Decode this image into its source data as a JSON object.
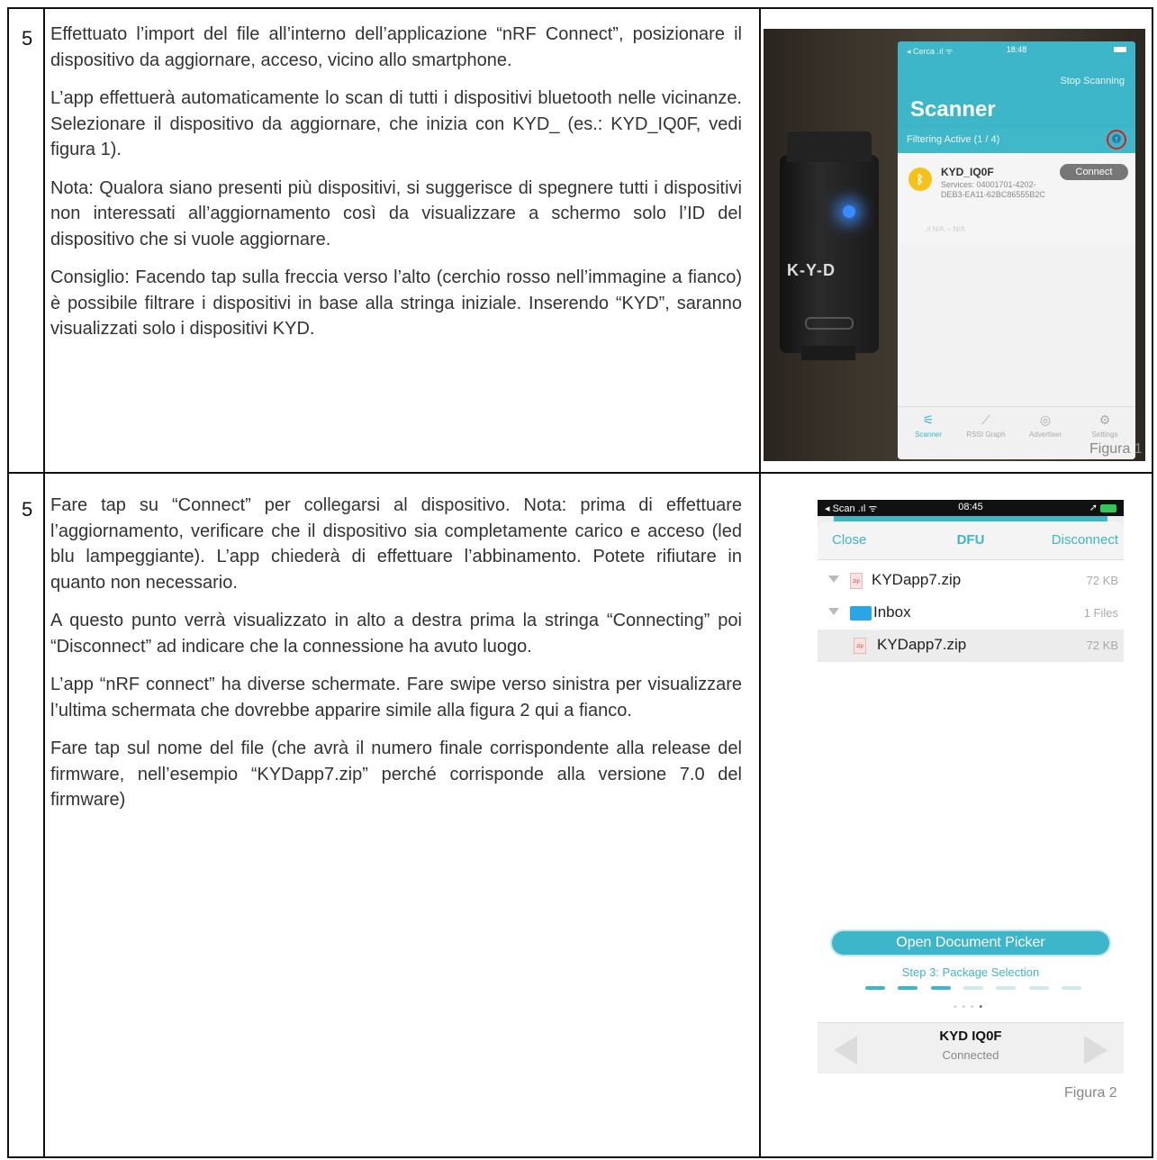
{
  "rows": [
    {
      "step": "5",
      "paragraphs": [
        "Effettuato l’import del file all’interno dell’applicazione “nRF Connect”, posizionare il dispositivo da aggiornare, acceso, vicino allo smartphone.",
        "L’app effettuerà automaticamente lo scan di tutti i dispositivi bluetooth nelle vicinanze. Selezionare il dispositivo da aggiornare, che inizia con KYD_ (es.: KYD_IQ0F, vedi figura 1).",
        "Nota: Qualora siano presenti più dispositivi, si suggerisce di spegnere tutti i dispositivi non interessati all’aggiornamento così da visualizzare a schermo solo l’ID del dispositivo che si vuole aggiornare.",
        "Consiglio: Facendo tap sulla freccia verso l’alto (cerchio rosso nell’immagine a fianco) è possibile filtrare i dispositivi in base alla stringa iniziale. Inserendo “KYD”, saranno visualizzati solo i dispositivi KYD."
      ],
      "caption": "Figura 1"
    },
    {
      "step": "5",
      "paragraphs": [
        "Fare tap su “Connect” per collegarsi al dispositivo. Nota: prima di effettuare l’aggiornamento, verificare che il dispositivo sia completamente carico e acceso (led blu lampeggiante). L’app chiederà di effettuare l’abbinamento. Potete rifiutare in quanto non necessario.",
        "A questo punto verrà visualizzato in alto a destra prima la stringa “Connecting” poi “Disconnect” ad indicare che la connessione ha avuto luogo.",
        "L’app “nRF connect” ha diverse schermate. Fare swipe verso sinistra per visualizzare l’ultima schermata che dovrebbe apparire simile alla figura 2 qui a fianco.",
        "Fare tap sul nome del file (che avrà il numero finale corrispondente alla release del firmware, nell’esempio “KYDapp7.zip” perché corrisponde alla versione 7.0 del firmware)"
      ],
      "caption": "Figura 2"
    }
  ],
  "figure1": {
    "device_logo": "K-Y-D",
    "status_left": "◂ Cerca .ıl ᯤ",
    "status_time": "18:48",
    "stop_scanning": "Stop Scanning",
    "title": "Scanner",
    "filter_text": "Filtering Active (1 / 4)",
    "device_name": "KYD_IQ0F",
    "connect_label": "Connect",
    "services": "Services: 04001701-4202-DEB3-EA11-62BC86555B2C",
    "rssi": ".ıl N/A  ◦◦ N/A",
    "tabs": [
      {
        "label": "Scanner",
        "icon": "scanner-icon"
      },
      {
        "label": "RSSI Graph",
        "icon": "graph-icon"
      },
      {
        "label": "Advertiser",
        "icon": "advertiser-icon"
      },
      {
        "label": "Settings",
        "icon": "settings-icon"
      }
    ]
  },
  "figure2": {
    "status_left": "◂ Scan .ıl ᯤ",
    "status_time": "08:45",
    "status_right": "➚",
    "close": "Close",
    "title": "DFU",
    "disconnect": "Disconnect",
    "files": [
      {
        "name": "KYDapp7.zip",
        "size": "72 KB"
      },
      {
        "name": "Inbox",
        "size": "1 Files"
      },
      {
        "name": "KYDapp7.zip",
        "size": "72 KB"
      }
    ],
    "open_picker": "Open Document Picker",
    "step_label": "Step 3: Package Selection",
    "progress_steps_done": 3,
    "progress_steps_total": 7,
    "device_name": "KYD IQ0F",
    "device_status": "Connected"
  },
  "colors": {
    "accent": "#3db6c9",
    "highlight": "#d42020"
  }
}
